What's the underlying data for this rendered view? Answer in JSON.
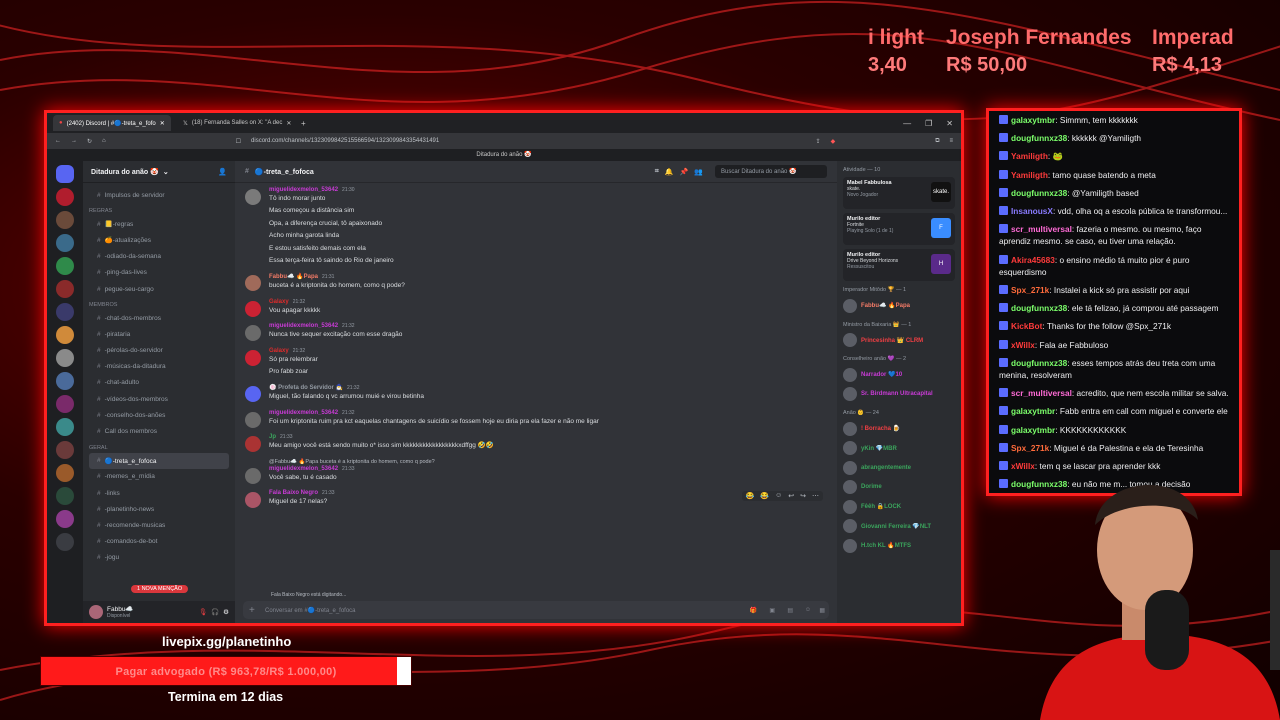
{
  "ticker": [
    {
      "name": "i light",
      "value": "3,40"
    },
    {
      "name": "Joseph Fernandes",
      "value": "R$ 50,00"
    },
    {
      "name": "Imperad",
      "value": "R$ 4,13"
    }
  ],
  "browser": {
    "tabs": [
      "(2402) Discord | #🔵-treta_e_fofo",
      "(18) Fernanda Salles on X: \"A dec"
    ],
    "url": "discord.com/channels/1323099842515566594/1323099843354431491",
    "window_title": "Ditadura do anão 🤡"
  },
  "discord": {
    "server_name": "Ditadura do anão 🤡",
    "channel_name": "🔵-treta_e_fofoca",
    "search_placeholder": "Buscar Ditadura do anão 🤡",
    "composer_placeholder": "Conversar em #🔵-treta_e_fofoca",
    "typing": "Fala Baixo Negro está digitando...",
    "mention_pill": "1 NOVA MENÇÃO",
    "user": {
      "name": "Fabbu☁️",
      "status": "Disponível"
    },
    "channels": [
      {
        "type": "item",
        "label": "Impulsos de servidor"
      },
      {
        "type": "cat",
        "label": "Regras"
      },
      {
        "type": "item",
        "label": "📒-regras"
      },
      {
        "type": "item",
        "label": "🍊-atualizações"
      },
      {
        "type": "item",
        "label": "-odiado-da-semana"
      },
      {
        "type": "item",
        "label": "-ping-das-lives"
      },
      {
        "type": "item",
        "label": "pegue-seu-cargo"
      },
      {
        "type": "cat",
        "label": "Membros"
      },
      {
        "type": "item",
        "label": "-chat-dos-membros"
      },
      {
        "type": "item",
        "label": "-pirataria"
      },
      {
        "type": "item",
        "label": "-pérolas-do-servidor"
      },
      {
        "type": "item",
        "label": "-músicas-da-ditadura"
      },
      {
        "type": "item",
        "label": "-chat-adulto"
      },
      {
        "type": "item",
        "label": "-vídeos-dos-membros"
      },
      {
        "type": "item",
        "label": "-conselho-dos-anões"
      },
      {
        "type": "item",
        "label": "Call dos membros"
      },
      {
        "type": "cat",
        "label": "Geral"
      },
      {
        "type": "active",
        "label": "🔵-treta_e_fofoca"
      },
      {
        "type": "item",
        "label": "-memes_e_mídia"
      },
      {
        "type": "item",
        "label": "-links"
      },
      {
        "type": "item",
        "label": "-planetinho-news"
      },
      {
        "type": "item",
        "label": "-recomende-musicas"
      },
      {
        "type": "item",
        "label": "-comandos-de-bot"
      },
      {
        "type": "item",
        "label": "-jogu"
      }
    ],
    "messages": [
      {
        "name": "miguelidexmelon_53642",
        "color": "#c93bd6",
        "ts": "21:30",
        "reply": "",
        "lines": [
          "Tô indo morar junto",
          "Mas começou a distância sim",
          "Opa, a diferença crucial, tô apaixonado",
          "Acho minha garota linda",
          "E estou satisfeito demais com ela",
          "Essa terça-feira tô saindo do Rio de janeiro"
        ]
      },
      {
        "name": "Fabbu☁️ 🔥Papa",
        "color": "#f47b67",
        "ts": "21:31",
        "reply": "",
        "lines": [
          "buceta é a kriptonita do homem, como q pode?"
        ]
      },
      {
        "name": "Galaxy",
        "color": "#e02b2b",
        "ts": "21:32",
        "reply": "",
        "lines": [
          "Vou apagar kkkkk"
        ]
      },
      {
        "name": "miguelidexmelon_53642",
        "color": "#c93bd6",
        "ts": "21:32",
        "reply": "",
        "lines": [
          "Nunca tive sequer excitação com esse dragão"
        ]
      },
      {
        "name": "Galaxy",
        "color": "#e02b2b",
        "ts": "21:32",
        "reply": "",
        "lines": [
          "Só pra relembrar",
          "Pro fabb zoar"
        ]
      },
      {
        "name": "🍥 Profeta do Servidor 🧙‍♂️",
        "color": "#949ba4",
        "ts": "21:32",
        "reply": "",
        "lines": [
          "Miguel, tão falando q vc arrumou muié e virou betinha"
        ]
      },
      {
        "name": "miguelidexmelon_53642",
        "color": "#c93bd6",
        "ts": "21:32",
        "reply": "",
        "lines": [
          "Foi um kriptonita ruim pra kct eaquelas chantagens de suicídio se fossem hoje eu diria pra ela fazer e não me ligar"
        ]
      },
      {
        "name": "Jp",
        "color": "#3ba55d",
        "ts": "21:33",
        "reply": "",
        "lines": [
          "Meu amigo você está sendo muito o* isso sim kkkkkkkkkkkkkkkkkxdffgg 🤣🤣"
        ]
      },
      {
        "name": "miguelidexmelon_53642",
        "color": "#c93bd6",
        "ts": "21:33",
        "reply": "@Fabbu☁️ 🔥Papa  buceta é a kriptonita do homem, como q pode?",
        "lines": [
          "Você sabe, tu é casado"
        ]
      },
      {
        "name": "Fala Baixo Negro",
        "color": "#c93bd6",
        "ts": "21:33",
        "reply": "",
        "lines": [
          "Miguel de 17 nelas?"
        ]
      }
    ],
    "activity_title": "Atividade — 10",
    "activities": [
      {
        "name": "Mabel Fabbulosa",
        "sub": "skate.",
        "detail": "Novo Jogador",
        "thumb": "#111",
        "thumb_label": "skate."
      },
      {
        "name": "Murilo editor",
        "sub": "Fortnite",
        "detail": "Playing Solo (1 de 1)",
        "thumb": "#3a8dff",
        "thumb_label": "F"
      },
      {
        "name": "Murilo editor",
        "sub": "Drive Beyond Horizons",
        "detail": "Ressuscitou",
        "thumb": "#5a2a8a",
        "thumb_label": "H"
      }
    ],
    "roles": [
      {
        "title": "Imperador Mitôdo 🏆 — 1",
        "members": [
          {
            "name": "Fabbu☁️ 🔥Papa",
            "color": "#f47b67"
          }
        ]
      },
      {
        "title": "Ministro da Baixaria 👑 — 1",
        "members": [
          {
            "name": "Princesinha 👑 CLRM",
            "color": "#f23f43"
          }
        ]
      },
      {
        "title": "Conselheiro anão 💜 — 2",
        "members": [
          {
            "name": "Narrador 💙10",
            "color": "#c93bd6"
          },
          {
            "name": "Sr. Birdmann Ultracapital",
            "color": "#c93bd6"
          }
        ]
      },
      {
        "title": "Anão 👶 — 24",
        "members": [
          {
            "name": "! Borracha 🍺",
            "color": "#f23f43"
          },
          {
            "name": "yKin 💎MBR",
            "color": "#3ba55d"
          },
          {
            "name": "abrangentemente",
            "color": "#3ba55d"
          },
          {
            "name": "Dorime",
            "color": "#3ba55d"
          },
          {
            "name": "Fêêh 🔒LOCK",
            "color": "#3ba55d"
          },
          {
            "name": "Giovanni Ferreira 💎NLT",
            "color": "#3ba55d"
          },
          {
            "name": "H.tch KL 🔥MTFS",
            "color": "#3ba55d"
          }
        ]
      }
    ]
  },
  "twitch_chat": [
    {
      "user": "galaxytmbr",
      "color": "#7cff6b",
      "text": "Simmm, tem kkkkkkk"
    },
    {
      "user": "dougfunnxz38",
      "color": "#7cff6b",
      "text": "kkkkkk @Yamiligth"
    },
    {
      "user": "Yamiligth",
      "color": "#ff3b3b",
      "text": "🐸"
    },
    {
      "user": "Yamiligth",
      "color": "#ff3b3b",
      "text": "tamo quase batendo a meta"
    },
    {
      "user": "dougfunnxz38",
      "color": "#7cff6b",
      "text": "@Yamiligth based"
    },
    {
      "user": "InsanousX",
      "color": "#8a7bff",
      "text": "vdd, olha oq a escola pública te transformou..."
    },
    {
      "user": "scr_multiversal",
      "color": "#ff6bd6",
      "text": "fazeria o mesmo. ou mesmo, faço aprendiz mesmo. se caso, eu tiver uma relação."
    },
    {
      "user": "Akira45683",
      "color": "#ff3b3b",
      "text": "o ensino médio tá muito pior é puro esquerdismo"
    },
    {
      "user": "Spx_271k",
      "color": "#ff6b3b",
      "text": "Instalei a kick só pra assistir por aqui"
    },
    {
      "user": "dougfunnxz38",
      "color": "#7cff6b",
      "text": "ele tá felizao, já comprou até passagem"
    },
    {
      "user": "KickBot",
      "color": "#ff3b3b",
      "text": "Thanks for the follow @Spx_271k"
    },
    {
      "user": "xWillx",
      "color": "#ff3b3b",
      "text": "Fala ae Fabbuloso"
    },
    {
      "user": "dougfunnxz38",
      "color": "#7cff6b",
      "text": "esses tempos atrás deu treta com uma menina, resolveram"
    },
    {
      "user": "scr_multiversal",
      "color": "#ff6bd6",
      "text": "acredito, que nem escola militar se salva."
    },
    {
      "user": "galaxytmbr",
      "color": "#7cff6b",
      "text": "Fabb entra em call com miguel e converte ele"
    },
    {
      "user": "galaxytmbr",
      "color": "#7cff6b",
      "text": "KKKKKKKKKKKK"
    },
    {
      "user": "Spx_271k",
      "color": "#ff6b3b",
      "text": "Miguel é da Palestina e ela de Teresinha"
    },
    {
      "user": "xWillx",
      "color": "#ff3b3b",
      "text": "tem q se lascar pra aprender kkk"
    },
    {
      "user": "dougfunnxz38",
      "color": "#7cff6b",
      "text": "eu não me m... tomou a decisão"
    }
  ],
  "goal": {
    "url": "livepix.gg/planetinho",
    "label": "Pagar advogado (R$ 963,78/R$ 1.000,00)",
    "progress": 0.9638,
    "ends": "Termina em 12 dias"
  }
}
